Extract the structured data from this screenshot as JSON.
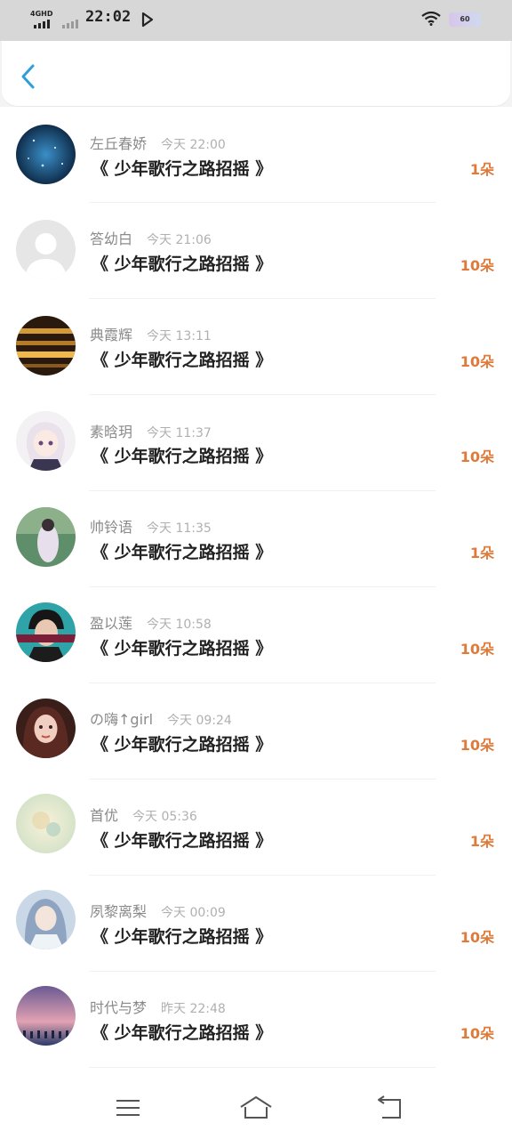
{
  "status_bar": {
    "network": "4GHD",
    "time": "22:02",
    "battery": "60"
  },
  "colors": {
    "accent": "#2e9fd8",
    "quantity": "#e07a3a",
    "name_text": "#8a8a8a",
    "time_text": "#b0b0b0"
  },
  "header": {
    "back_icon": "chevron-left-icon"
  },
  "gifts": [
    {
      "name": "左丘春娇",
      "time": "今天 22:00",
      "title": "《 少年歌行之路招摇 》",
      "quantity": "1朵"
    },
    {
      "name": "答幼白",
      "time": "今天 21:06",
      "title": "《 少年歌行之路招摇 》",
      "quantity": "10朵"
    },
    {
      "name": "典霞辉",
      "time": "今天 13:11",
      "title": "《 少年歌行之路招摇 》",
      "quantity": "10朵"
    },
    {
      "name": "素晗玥",
      "time": "今天 11:37",
      "title": "《 少年歌行之路招摇 》",
      "quantity": "10朵"
    },
    {
      "name": "帅铃语",
      "time": "今天 11:35",
      "title": "《 少年歌行之路招摇 》",
      "quantity": "1朵"
    },
    {
      "name": "盈以莲",
      "time": "今天 10:58",
      "title": "《 少年歌行之路招摇 》",
      "quantity": "10朵"
    },
    {
      "name": "の嗨↑girl",
      "time": "今天 09:24",
      "title": "《 少年歌行之路招摇 》",
      "quantity": "10朵"
    },
    {
      "name": "首优",
      "time": "今天 05:36",
      "title": "《 少年歌行之路招摇 》",
      "quantity": "1朵"
    },
    {
      "name": "夙黎离梨",
      "time": "今天 00:09",
      "title": "《 少年歌行之路招摇 》",
      "quantity": "10朵"
    },
    {
      "name": "时代与梦",
      "time": "昨天 22:48",
      "title": "《 少年歌行之路招摇 》",
      "quantity": "10朵"
    }
  ],
  "nav_bar": {
    "menu_icon": "menu-icon",
    "home_icon": "home-icon",
    "back_icon": "back-icon"
  }
}
